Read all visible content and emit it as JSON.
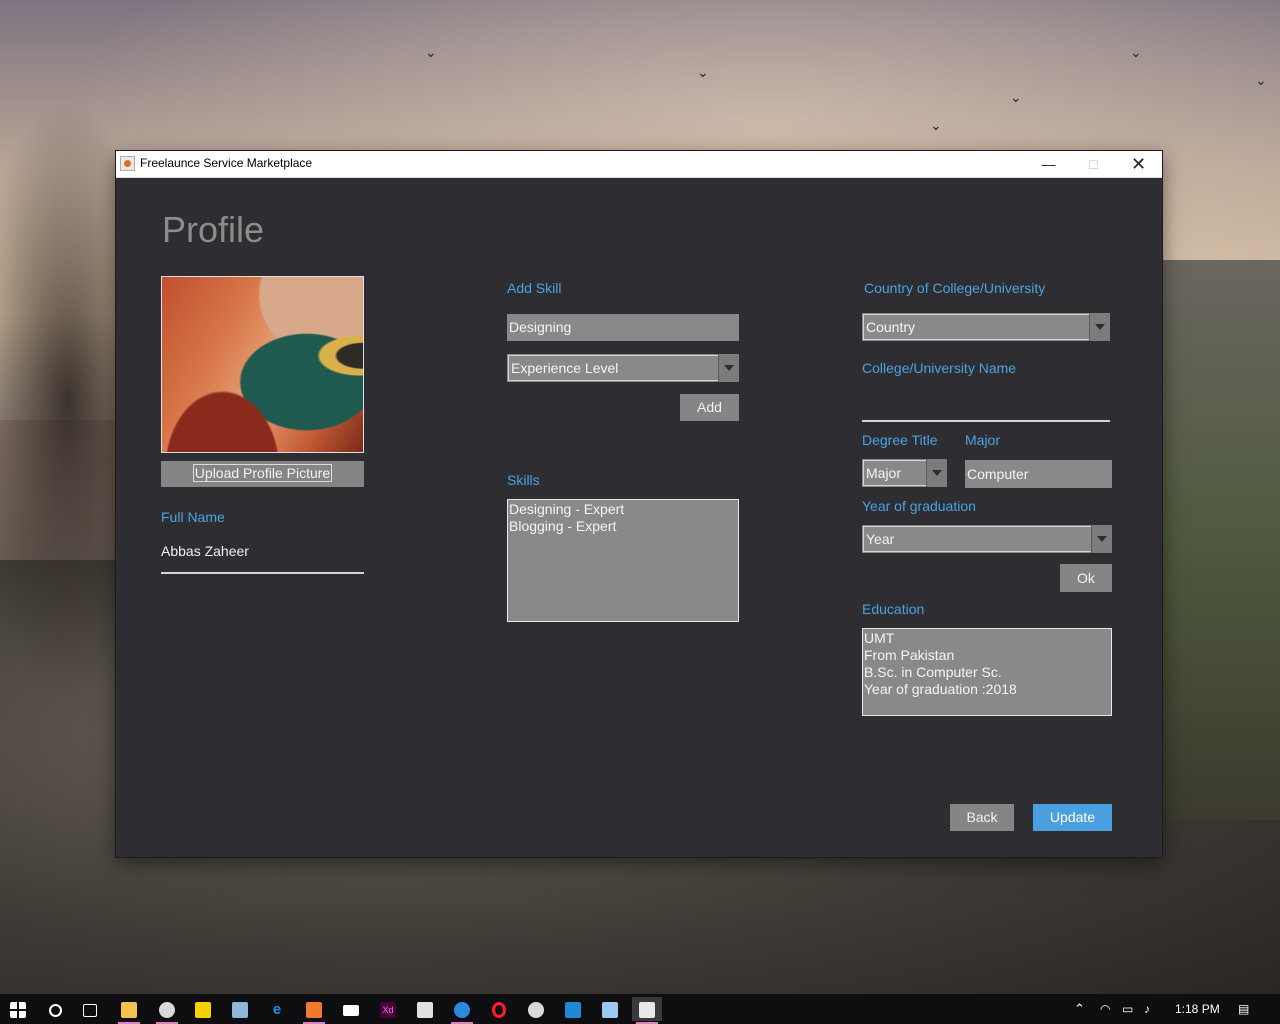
{
  "window": {
    "title": "Freelaunce Service Marketplace"
  },
  "page": {
    "title": "Profile"
  },
  "profile": {
    "upload_label": "Upload Profile Picture",
    "full_name_label": "Full Name",
    "full_name_value": "Abbas Zaheer"
  },
  "skills": {
    "add_skill_label": "Add Skill",
    "skill_input_value": "Designing",
    "experience_selected": "Experience Level",
    "add_button": "Add",
    "skills_label": "Skills",
    "list": [
      "Designing - Expert",
      "Blogging - Expert"
    ]
  },
  "education": {
    "country_label": "Country of College/University",
    "country_selected": "Country",
    "college_name_label": "College/University Name",
    "college_name_value": "",
    "degree_title_label": "Degree Title",
    "degree_selected": "Major",
    "major_label": "Major",
    "major_value": "Computer",
    "year_label": "Year of graduation",
    "year_selected": "Year",
    "ok_button": "Ok",
    "education_label": "Education",
    "education_lines": [
      "UMT",
      "From Pakistan",
      "B.Sc. in Computer Sc.",
      "Year of graduation :2018"
    ]
  },
  "actions": {
    "back": "Back",
    "update": "Update"
  },
  "taskbar": {
    "time": "1:18 PM",
    "apps": [
      "start-icon",
      "search-icon",
      "task-view-icon",
      "file-explorer-icon",
      "paint-icon",
      "sticky-notes-icon",
      "remote-desktop-icon",
      "edge-icon",
      "xampp-icon",
      "mail-icon",
      "adobe-xd-icon",
      "store-icon",
      "firefox-icon",
      "opera-icon",
      "paint3d-icon",
      "vscode-icon",
      "virtualbox-icon",
      "java-app-icon"
    ]
  },
  "colors": {
    "accent_blue": "#4aa3df",
    "update_button": "#4a9fe0",
    "window_bg": "#2e2d31"
  }
}
